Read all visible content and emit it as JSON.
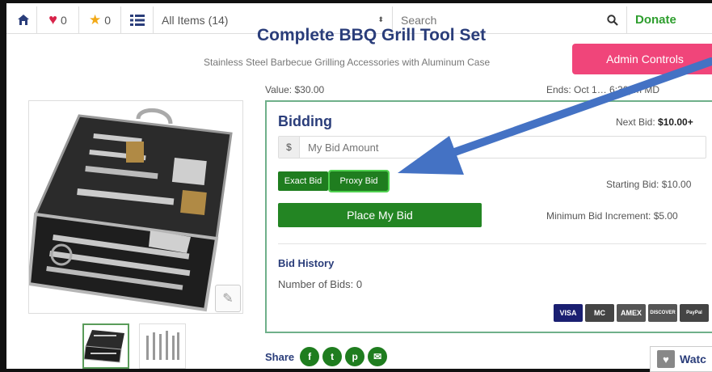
{
  "topbar": {
    "heart_count": "0",
    "star_count": "0",
    "category_select": "All Items (14)",
    "search_placeholder": "Search",
    "donate_label": "Donate"
  },
  "item": {
    "title": "Complete BBQ Grill Tool Set",
    "subtitle": "Stainless Steel Barbecue Grilling Accessories with Aluminum Case",
    "value_text": "Value: $30.00",
    "ends_text": "Ends: Oct 1… 6:30pm MD",
    "admin_label": "Admin Controls"
  },
  "bidding": {
    "title": "Bidding",
    "next_bid_label": "Next Bid:",
    "next_bid_value": "$10.00+",
    "amount_prefix": "$",
    "amount_placeholder": "My Bid Amount",
    "exact_bid_label": "Exact Bid",
    "proxy_bid_label": "Proxy Bid",
    "starting_bid": "Starting Bid: $10.00",
    "place_bid_label": "Place My Bid",
    "min_increment": "Minimum Bid Increment: $5.00",
    "history_title": "Bid History",
    "number_of_bids": "Number of Bids: 0",
    "cards": [
      {
        "name": "visa-card-icon",
        "label": "VISA",
        "bg": "#1a1f71",
        "w": 36
      },
      {
        "name": "mastercard-icon",
        "label": "MC",
        "bg": "#444444",
        "w": 36
      },
      {
        "name": "amex-card-icon",
        "label": "AMEX",
        "bg": "#555555",
        "w": 36
      },
      {
        "name": "discover-card-icon",
        "label": "DISCOVER",
        "bg": "#555555",
        "w": 36
      },
      {
        "name": "paypal-card-icon",
        "label": "PayPal",
        "bg": "#444444",
        "w": 36
      }
    ]
  },
  "share": {
    "label": "Share",
    "icons": [
      "f",
      "t",
      "p",
      "✉"
    ]
  },
  "watch": {
    "label": "Watc"
  },
  "colors": {
    "accent_green": "#1f7d1f",
    "title_blue": "#2a3d7a",
    "admin_pink": "#f0457a",
    "arrow_blue": "#4472c4"
  }
}
